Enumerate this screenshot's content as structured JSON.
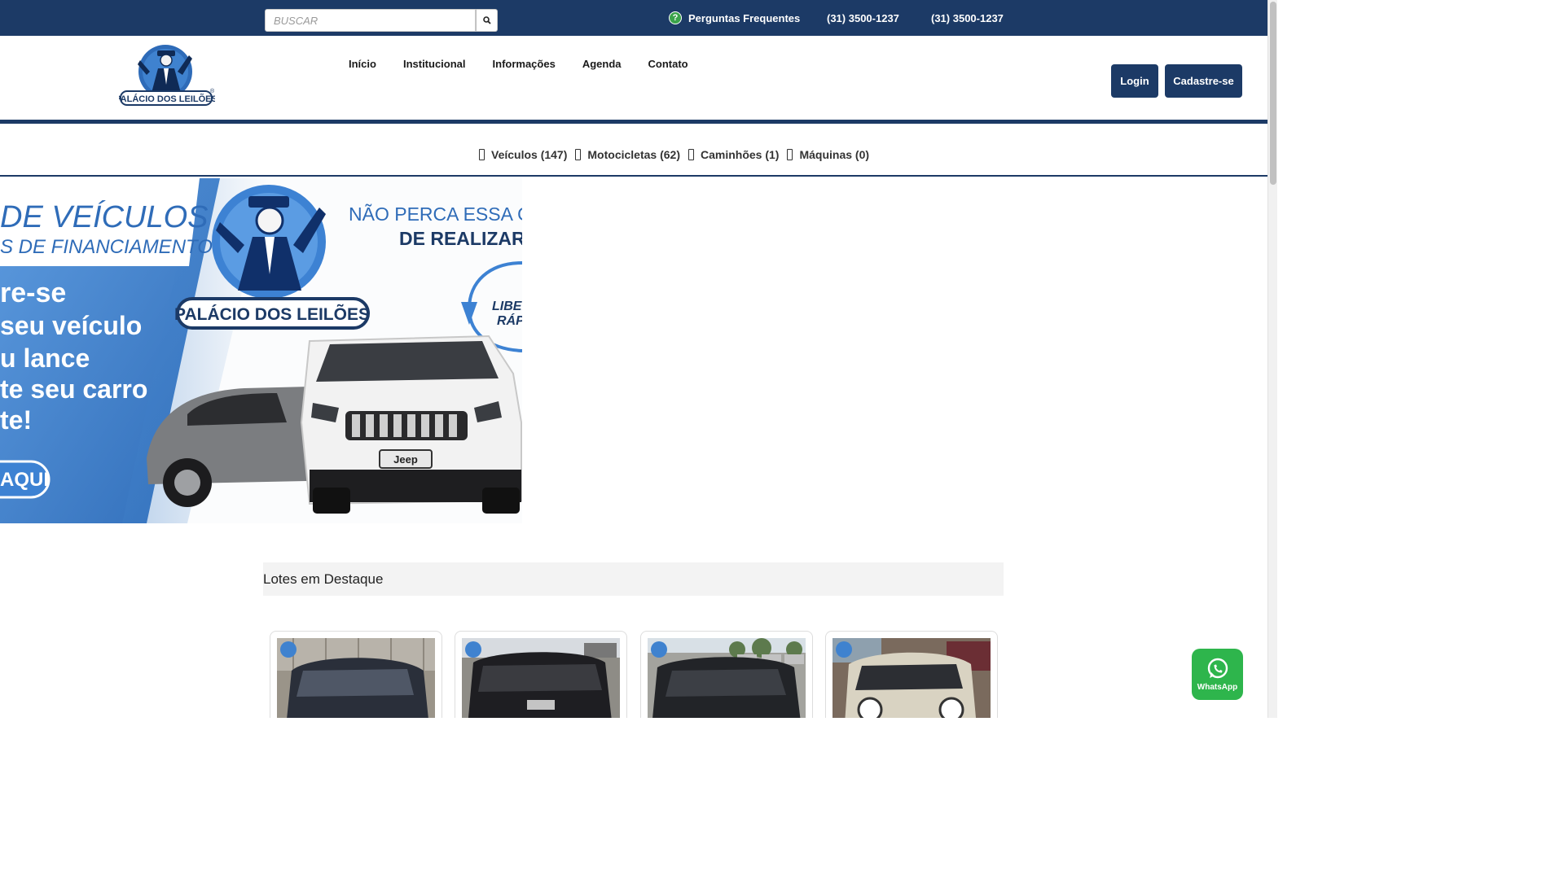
{
  "search": {
    "placeholder": "BUSCAR"
  },
  "topbar": {
    "faq_label": "Perguntas Frequentes",
    "phone_1": "(31) 3500-1237",
    "phone_2": "(31) 3500-1237"
  },
  "brand": {
    "logo_text": "PALÁCIO DOS LEILÕES"
  },
  "nav": {
    "items": [
      {
        "label": " Início"
      },
      {
        "label": " Institucional"
      },
      {
        "label": " Informações"
      },
      {
        "label": " Agenda"
      },
      {
        "label": " Contato"
      }
    ]
  },
  "auth": {
    "login_label": "Login",
    "register_label": "Cadastre-se"
  },
  "categories": [
    {
      "label": "Veículos (147)"
    },
    {
      "label": "Motocicletas (62)"
    },
    {
      "label": "Caminhões (1)"
    },
    {
      "label": "Máquinas (0)"
    }
  ],
  "banner": {
    "line1": "DE VEÍCULOS",
    "line2": "S DE FINANCIAMENTO",
    "headline_right_1": "NÃO PERCA ESSA O",
    "headline_right_2": "DE REALIZAR",
    "left_lines": [
      "re-se",
      "seu veículo",
      "u lance",
      "te seu carro",
      "te!"
    ],
    "cta": "AQUI",
    "side_text_1": "LIBER",
    "side_text_2": "RÁPI",
    "logo_text": "PALÁCIO DOS LEILÕES",
    "plate_text": "Jeep"
  },
  "highlights": {
    "title": "Lotes em Destaque",
    "lots": [
      {
        "name": "lot-1",
        "car_color": "#2a2f3a"
      },
      {
        "name": "lot-2",
        "car_color": "#1e1e22"
      },
      {
        "name": "lot-3",
        "car_color": "#222428"
      },
      {
        "name": "lot-4",
        "car_color": "#d9d3c2"
      }
    ]
  },
  "whatsapp": {
    "label": "WhatsApp"
  },
  "colors": {
    "brand_navy": "#1c3a66",
    "whatsapp_green": "#2eb54c",
    "banner_blue": "#4a8ad4"
  }
}
